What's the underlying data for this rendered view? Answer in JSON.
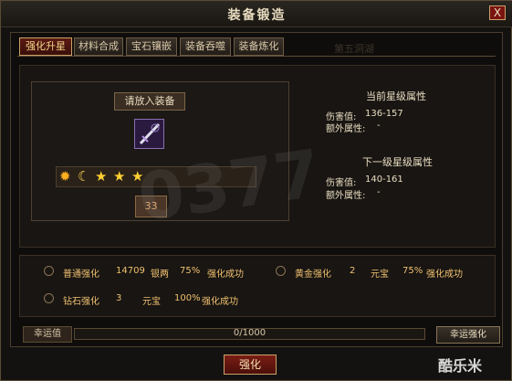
{
  "window": {
    "title": "装备锻造",
    "close_label": "X"
  },
  "tabs": [
    {
      "label": "强化升星",
      "active": true
    },
    {
      "label": "材料合成",
      "active": false
    },
    {
      "label": "宝石镶嵌",
      "active": false
    },
    {
      "label": "装备吞噬",
      "active": false
    },
    {
      "label": "装备炼化",
      "active": false
    }
  ],
  "hidden_tab": "第五洞湖",
  "equip": {
    "place_label": "请放入装备",
    "level": "33",
    "stars": [
      "sun-icon",
      "moon-icon",
      "star-icon",
      "star-icon",
      "star-icon"
    ]
  },
  "current": {
    "heading": "当前星级属性",
    "damage_label": "伤害值:",
    "damage_value": "136-157",
    "extra_label": "额外属性:",
    "extra_value": "-"
  },
  "next": {
    "heading": "下一级星级属性",
    "damage_label": "伤害值:",
    "damage_value": "140-161",
    "extra_label": "额外属性:",
    "extra_value": "-"
  },
  "options": [
    {
      "name": "普通强化",
      "amount": "14709",
      "currency": "银两",
      "rate": "75%",
      "result": "强化成功"
    },
    {
      "name": "黄金强化",
      "amount": "2",
      "currency": "元宝",
      "rate": "75%",
      "result": "强化成功"
    },
    {
      "name": "钻石强化",
      "amount": "3",
      "currency": "元宝",
      "rate": "100%",
      "result": "强化成功"
    }
  ],
  "luck": {
    "label": "幸运值",
    "value_text": "0/1000",
    "progress": 0.0,
    "button": "幸运强化"
  },
  "strengthen_button": "强化",
  "watermark": {
    "logo": "酷乐米",
    "big": "0377"
  }
}
